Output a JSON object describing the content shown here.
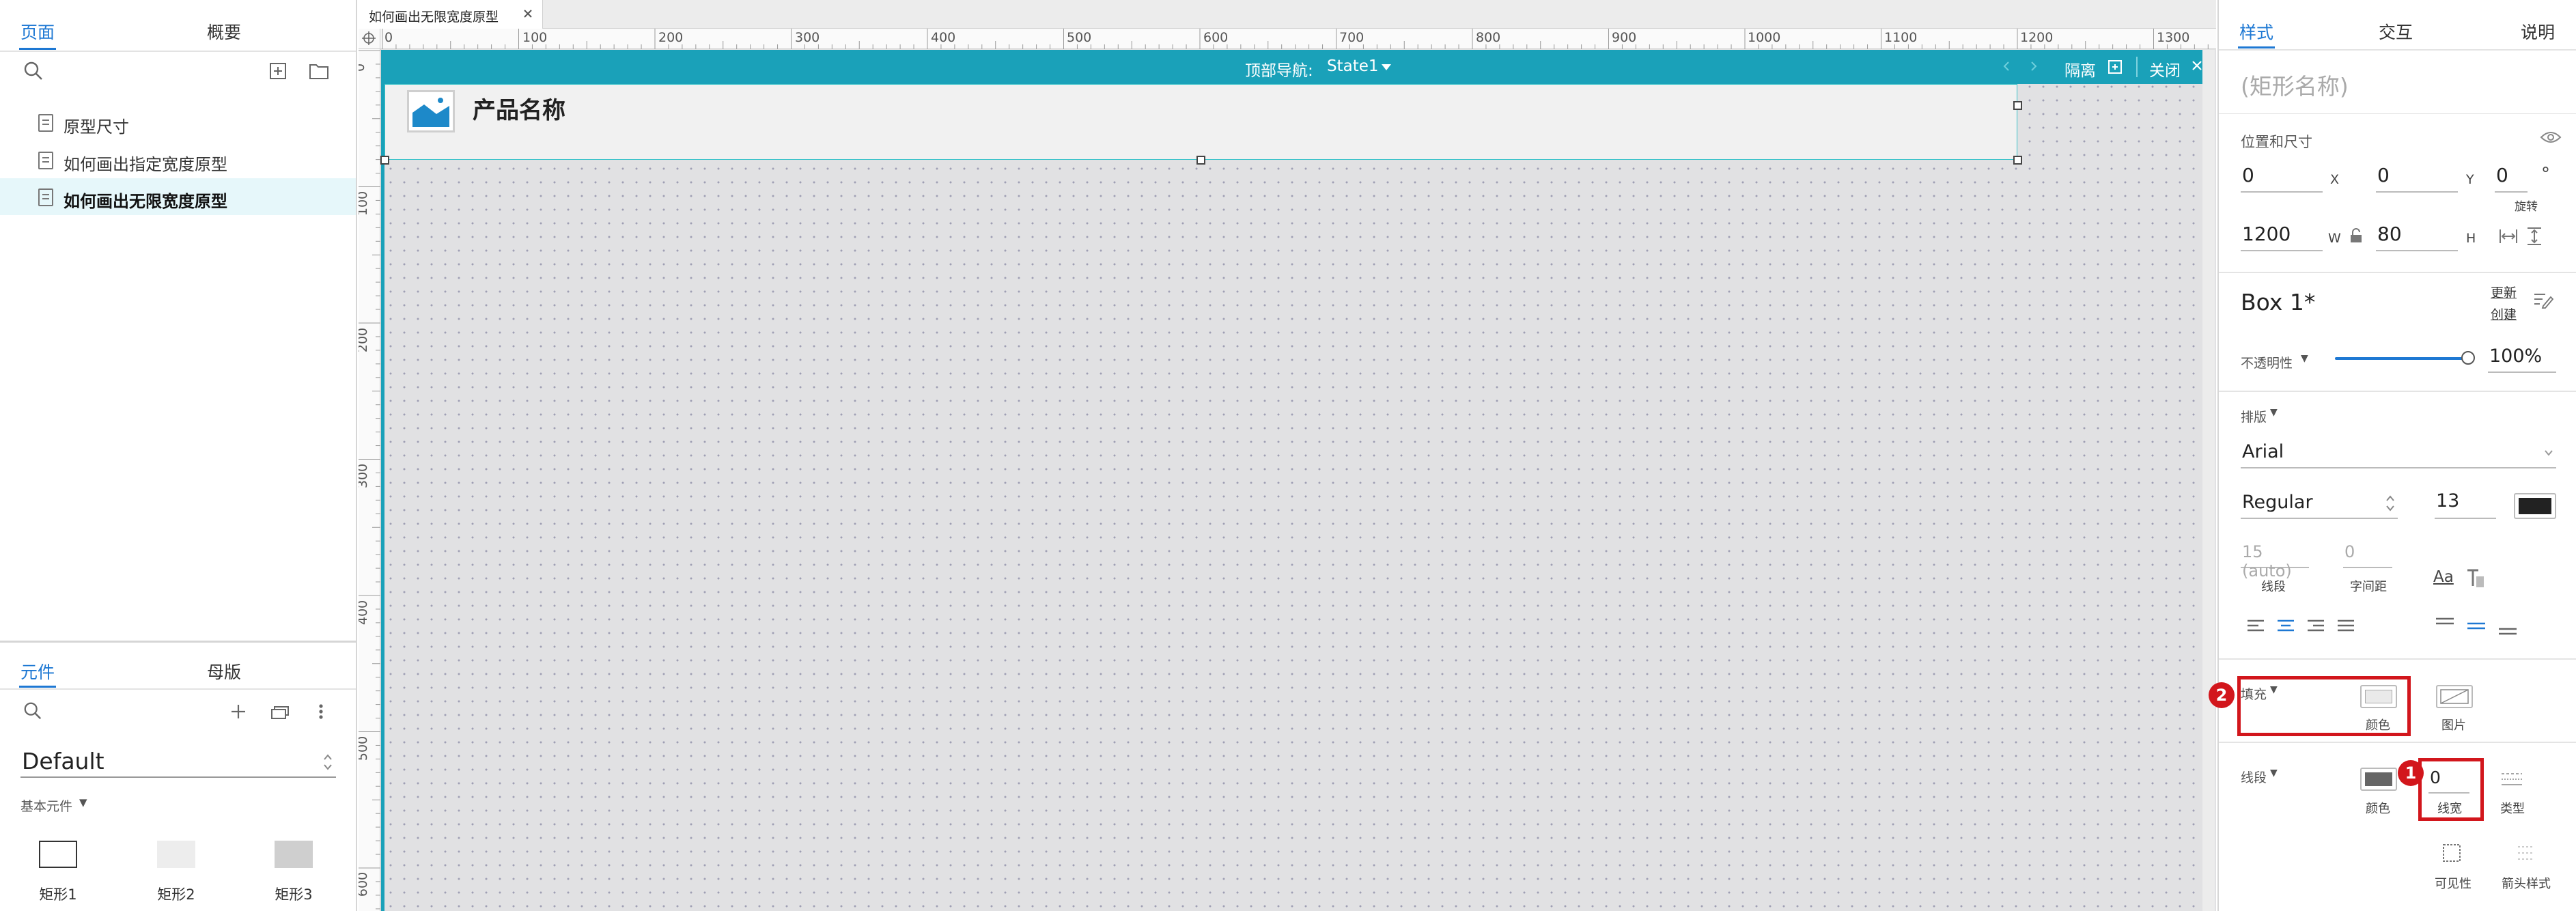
{
  "left_panel": {
    "tabs": [
      {
        "label": "页面"
      },
      {
        "label": "概要"
      }
    ],
    "pages": [
      {
        "label": "原型尺寸"
      },
      {
        "label": "如何画出指定宽度原型"
      },
      {
        "label": "如何画出无限宽度原型"
      }
    ],
    "library_tabs": [
      {
        "label": "元件"
      },
      {
        "label": "母版"
      }
    ],
    "library_name": "Default",
    "category": "基本元件",
    "components": [
      {
        "label": "矩形1"
      },
      {
        "label": "矩形2"
      },
      {
        "label": "矩形3"
      }
    ]
  },
  "canvas": {
    "file_tab": "如何画出无限宽度原型",
    "h_ruler": [
      "0",
      "100",
      "200",
      "300",
      "400",
      "500",
      "600",
      "700",
      "800",
      "900",
      "1000",
      "1100",
      "1200",
      "1300"
    ],
    "v_ruler": [
      "0",
      "100",
      "200",
      "300",
      "400",
      "500",
      "600"
    ],
    "focus_bar": {
      "label": "顶部导航:",
      "state": "State1",
      "isolate": "隔离",
      "close": "关闭"
    },
    "header_title": "产品名称"
  },
  "right_panel": {
    "tabs": [
      {
        "label": "样式"
      },
      {
        "label": "交互"
      },
      {
        "label": "说明"
      }
    ],
    "name_placeholder": "(矩形名称)",
    "position_size_label": "位置和尺寸",
    "x": "0",
    "x_label": "X",
    "y": "0",
    "y_label": "Y",
    "rotation": "0",
    "degree": "°",
    "rotation_label": "旋转",
    "w": "1200",
    "w_label": "W",
    "h": "80",
    "h_label": "H",
    "style_name": "Box 1*",
    "update_label": "更新",
    "create_label": "创建",
    "opacity_label": "不透明性",
    "opacity_value": "100%",
    "opacity": 1.0,
    "typography_label": "排版",
    "font": "Arial",
    "weight": "Regular",
    "font_size": "13",
    "font_color": "#222222",
    "line_spacing": "15 (auto)",
    "line_spacing_label": "线段",
    "char_spacing": "0",
    "char_spacing_label": "字间距",
    "aa_label": "Aa",
    "fill_label": "填充",
    "fill_color_label": "颜色",
    "fill_image_label": "图片",
    "border_label": "线段",
    "border_color_label": "颜色",
    "border_width": "0",
    "border_width_label": "线宽",
    "border_type_label": "类型",
    "visibility_label": "可见性",
    "arrow_label": "箭头样式",
    "badge1": "1",
    "badge2": "2"
  },
  "colors": {
    "accent": "#1e78d3",
    "teal": "#1aa1b9",
    "highlight_red": "#d2161c",
    "selection": "#e6f7fa"
  }
}
